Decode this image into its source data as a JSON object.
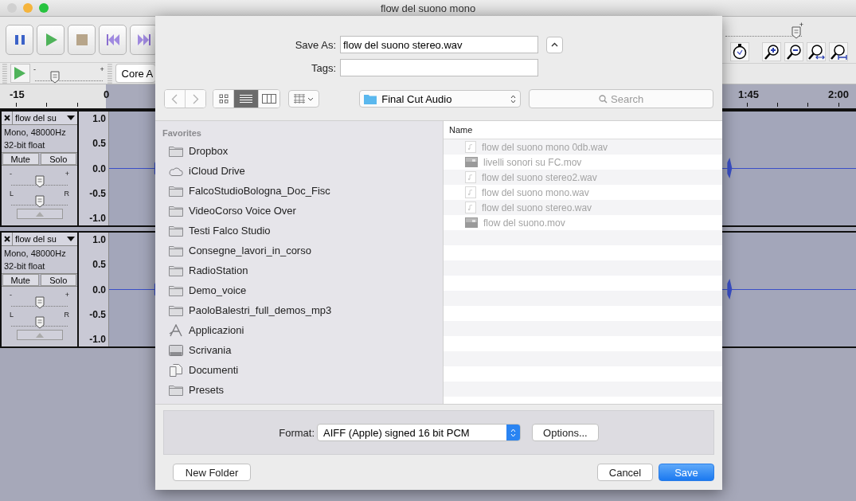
{
  "window": {
    "title": "flow del suono mono"
  },
  "transport": [
    {
      "kind": "pause"
    },
    {
      "kind": "play"
    },
    {
      "kind": "stop"
    },
    {
      "kind": "skip-start"
    },
    {
      "kind": "skip-end"
    }
  ],
  "play_at_speed": {
    "level": 0.3,
    "min_label": "-",
    "max_label": "+"
  },
  "audio_host": "Core A",
  "meter_slider": {
    "level": 0.93,
    "max_label": "+"
  },
  "tools": [
    {
      "kind": "timer"
    },
    {
      "kind": "zoom-in"
    },
    {
      "kind": "zoom-out"
    },
    {
      "kind": "fit"
    },
    {
      "kind": "fit-vertical"
    }
  ],
  "ruler": {
    "left_labels": [
      "-15",
      "0"
    ],
    "right_labels": [
      "1:45",
      "2:00"
    ]
  },
  "tracks": [
    {
      "name": "flow del su",
      "format": "Mono, 48000Hz",
      "sample": "32-bit float",
      "mute": "Mute",
      "solo": "Solo",
      "gain": {
        "level": 0.5,
        "min_label": "-",
        "max_label": "+"
      },
      "pan": {
        "level": 0.5,
        "min_label": "L",
        "max_label": "R"
      },
      "scale": [
        "1.0",
        "0.5",
        "0.0",
        "-0.5",
        "-1.0"
      ]
    },
    {
      "name": "flow del su",
      "format": "Mono, 48000Hz",
      "sample": "32-bit float",
      "mute": "Mute",
      "solo": "Solo",
      "gain": {
        "level": 0.5,
        "min_label": "-",
        "max_label": "+"
      },
      "pan": {
        "level": 0.5,
        "min_label": "L",
        "max_label": "R"
      },
      "scale": [
        "1.0",
        "0.5",
        "0.0",
        "-0.5",
        "-1.0"
      ]
    }
  ],
  "dialog": {
    "save_as_label": "Save As:",
    "save_as_value": "flow del suono stereo.wav",
    "tags_label": "Tags:",
    "view_modes": [
      {
        "kind": "icons",
        "selected": false
      },
      {
        "kind": "list",
        "selected": true
      },
      {
        "kind": "columns",
        "selected": false
      }
    ],
    "location": "Final Cut Audio",
    "search_placeholder": "Search",
    "sidebar": {
      "heading": "Favorites",
      "items": [
        {
          "label": "Dropbox",
          "kind": "folder"
        },
        {
          "label": "iCloud Drive",
          "kind": "cloud"
        },
        {
          "label": "FalcoStudioBologna_Doc_Fisc",
          "kind": "folder"
        },
        {
          "label": "VideoCorso Voice Over",
          "kind": "folder"
        },
        {
          "label": "Testi Falco Studio",
          "kind": "folder"
        },
        {
          "label": "Consegne_lavori_in_corso",
          "kind": "folder"
        },
        {
          "label": "RadioStation",
          "kind": "folder"
        },
        {
          "label": "Demo_voice",
          "kind": "folder"
        },
        {
          "label": "PaoloBalestri_full_demos_mp3",
          "kind": "folder"
        },
        {
          "label": "Applicazioni",
          "kind": "apps"
        },
        {
          "label": "Scrivania",
          "kind": "desktop"
        },
        {
          "label": "Documenti",
          "kind": "documents"
        },
        {
          "label": "Presets",
          "kind": "folder"
        }
      ]
    },
    "file_list": {
      "column": "Name",
      "files": [
        {
          "name": "flow del suono mono 0db.wav",
          "kind": "audio",
          "disabled": true
        },
        {
          "name": "livelli sonori su FC.mov",
          "kind": "video",
          "disabled": true
        },
        {
          "name": "flow del suono stereo2.wav",
          "kind": "audio",
          "disabled": true
        },
        {
          "name": "flow del suono mono.wav",
          "kind": "audio",
          "disabled": true
        },
        {
          "name": "flow del suono stereo.wav",
          "kind": "audio",
          "disabled": true
        },
        {
          "name": "flow del suono.mov",
          "kind": "video",
          "disabled": true
        }
      ]
    },
    "format_label": "Format:",
    "format_value": "AIFF (Apple) signed 16 bit PCM",
    "options_button": "Options...",
    "new_folder_button": "New Folder",
    "cancel_button": "Cancel",
    "save_button": "Save"
  }
}
